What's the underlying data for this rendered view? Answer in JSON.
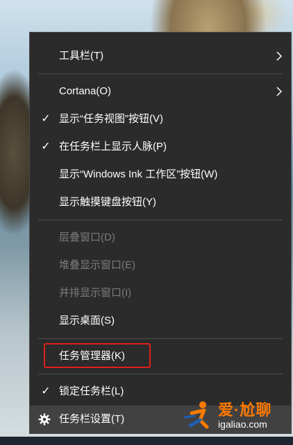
{
  "context_menu": {
    "items": [
      {
        "label": "工具栏(T)",
        "checked": false,
        "submenu": true,
        "disabled": false
      },
      {
        "label": "Cortana(O)",
        "checked": false,
        "submenu": true,
        "disabled": false
      },
      {
        "label": "显示“任务视图”按钮(V)",
        "checked": true,
        "submenu": false,
        "disabled": false
      },
      {
        "label": "在任务栏上显示人脉(P)",
        "checked": true,
        "submenu": false,
        "disabled": false
      },
      {
        "label": "显示“Windows Ink 工作区”按钮(W)",
        "checked": false,
        "submenu": false,
        "disabled": false
      },
      {
        "label": "显示触摸键盘按钮(Y)",
        "checked": false,
        "submenu": false,
        "disabled": false
      },
      {
        "label": "层叠窗口(D)",
        "checked": false,
        "submenu": false,
        "disabled": true
      },
      {
        "label": "堆叠显示窗口(E)",
        "checked": false,
        "submenu": false,
        "disabled": true
      },
      {
        "label": "并排显示窗口(I)",
        "checked": false,
        "submenu": false,
        "disabled": true
      },
      {
        "label": "显示桌面(S)",
        "checked": false,
        "submenu": false,
        "disabled": false
      },
      {
        "label": "任务管理器(K)",
        "checked": false,
        "submenu": false,
        "disabled": false,
        "highlighted": true
      },
      {
        "label": "锁定任务栏(L)",
        "checked": true,
        "submenu": false,
        "disabled": false
      },
      {
        "label": "任务栏设置(T)",
        "checked": false,
        "submenu": false,
        "disabled": false,
        "icon": "gear-icon"
      }
    ],
    "check_glyph": "✓",
    "highlight_color": "#e0201d"
  },
  "watermark": {
    "title": "爱·尬聊",
    "url": "igaliao.com",
    "color": "#ff7a00"
  }
}
